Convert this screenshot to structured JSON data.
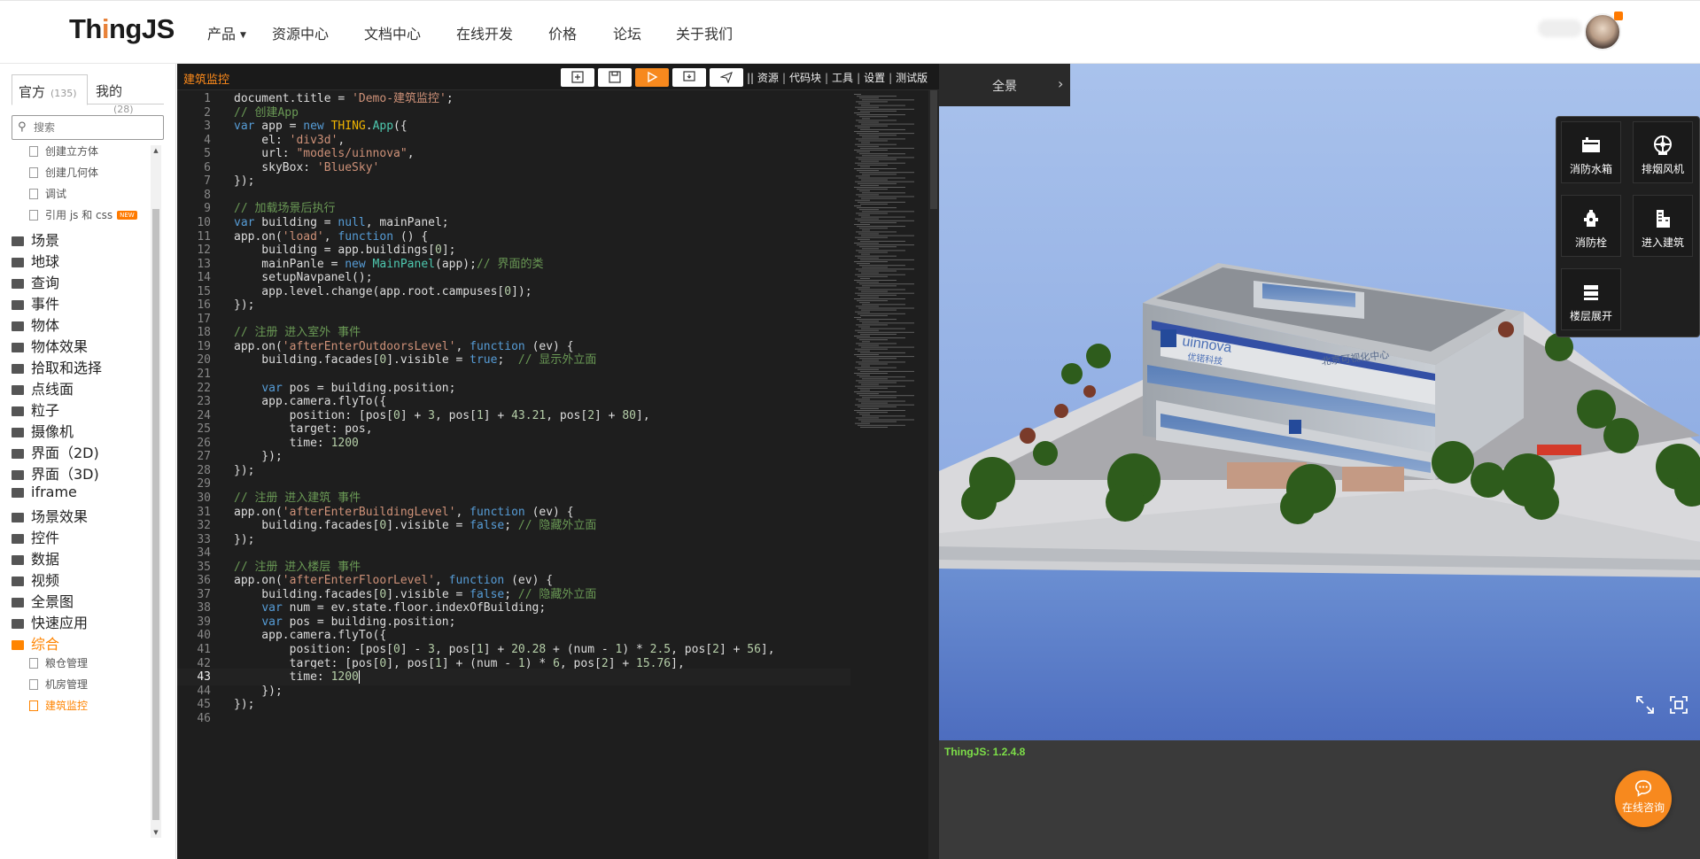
{
  "header": {
    "logo": {
      "prefix": "Th",
      "dot": "i",
      "suffix": "ngJS"
    },
    "nav": [
      {
        "label": "产品",
        "has_dropdown": true
      },
      {
        "label": "资源中心"
      },
      {
        "label": "文档中心"
      },
      {
        "label": "在线开发"
      },
      {
        "label": "价格"
      },
      {
        "label": "论坛"
      },
      {
        "label": "关于我们"
      }
    ]
  },
  "sidebar": {
    "tabs": [
      {
        "label": "官方",
        "count": "(135)",
        "active": true
      },
      {
        "label": "我的",
        "count": "(28)"
      }
    ],
    "search_placeholder": "搜索",
    "items": [
      {
        "type": "sub",
        "label": "创建立方体"
      },
      {
        "type": "sub",
        "label": "创建几何体"
      },
      {
        "type": "sub",
        "label": "调试"
      },
      {
        "type": "sub",
        "label": "引用 js 和 css",
        "badge": "NEW"
      },
      {
        "type": "cat",
        "label": "场景"
      },
      {
        "type": "cat",
        "label": "地球"
      },
      {
        "type": "cat",
        "label": "查询"
      },
      {
        "type": "cat",
        "label": "事件"
      },
      {
        "type": "cat",
        "label": "物体"
      },
      {
        "type": "cat",
        "label": "物体效果"
      },
      {
        "type": "cat",
        "label": "拾取和选择"
      },
      {
        "type": "cat",
        "label": "点线面"
      },
      {
        "type": "cat",
        "label": "粒子"
      },
      {
        "type": "cat",
        "label": "摄像机"
      },
      {
        "type": "cat",
        "label": "界面（2D)"
      },
      {
        "type": "cat",
        "label": "界面（3D)"
      },
      {
        "type": "cat",
        "label": "iframe"
      },
      {
        "type": "cat",
        "label": "场景效果"
      },
      {
        "type": "cat",
        "label": "控件"
      },
      {
        "type": "cat",
        "label": "数据"
      },
      {
        "type": "cat",
        "label": "视频"
      },
      {
        "type": "cat",
        "label": "全景图"
      },
      {
        "type": "cat",
        "label": "快速应用"
      },
      {
        "type": "cat",
        "label": "综合",
        "open": true
      },
      {
        "type": "sub",
        "label": "粮仓管理"
      },
      {
        "type": "sub",
        "label": "机房管理"
      },
      {
        "type": "sub",
        "label": "建筑监控",
        "active": true
      }
    ]
  },
  "editor": {
    "title": "建筑监控",
    "toolbar_buttons": [
      {
        "name": "new-file"
      },
      {
        "name": "save"
      },
      {
        "name": "run"
      },
      {
        "name": "screenshot"
      },
      {
        "name": "share"
      }
    ],
    "toolbar_links": [
      "资源",
      "代码块",
      "工具",
      "设置",
      "测试版"
    ],
    "toolbar_prefix": "||",
    "current_line": 43,
    "code": [
      [
        [
          "p",
          "document.title = "
        ],
        [
          "s",
          "'Demo-建筑监控'"
        ],
        [
          "p",
          ";"
        ]
      ],
      [
        [
          "c",
          "// 创建App"
        ]
      ],
      [
        [
          "k",
          "var"
        ],
        [
          "p",
          " app = "
        ],
        [
          "k",
          "new"
        ],
        [
          "p",
          " "
        ],
        [
          "y",
          "THING"
        ],
        [
          "p",
          "."
        ],
        [
          "t",
          "App"
        ],
        [
          "p",
          "({"
        ]
      ],
      [
        [
          "p",
          "    el: "
        ],
        [
          "s",
          "'div3d'"
        ],
        [
          "p",
          ","
        ]
      ],
      [
        [
          "p",
          "    url: "
        ],
        [
          "s",
          "\"models/uinnova\""
        ],
        [
          "p",
          ","
        ]
      ],
      [
        [
          "p",
          "    skyBox: "
        ],
        [
          "s",
          "'BlueSky'"
        ]
      ],
      [
        [
          "p",
          "});"
        ]
      ],
      [
        [
          "p",
          ""
        ]
      ],
      [
        [
          "c",
          "// 加载场景后执行"
        ]
      ],
      [
        [
          "k",
          "var"
        ],
        [
          "p",
          " building = "
        ],
        [
          "k",
          "null"
        ],
        [
          "p",
          ", mainPanel;"
        ]
      ],
      [
        [
          "p",
          "app.on("
        ],
        [
          "s",
          "'load'"
        ],
        [
          "p",
          ", "
        ],
        [
          "k",
          "function"
        ],
        [
          "p",
          " () {"
        ]
      ],
      [
        [
          "p",
          "    building = app.buildings["
        ],
        [
          "n",
          "0"
        ],
        [
          "p",
          "];"
        ]
      ],
      [
        [
          "p",
          "    mainPanle = "
        ],
        [
          "k",
          "new"
        ],
        [
          "p",
          " "
        ],
        [
          "t",
          "MainPanel"
        ],
        [
          "p",
          "(app);"
        ],
        [
          "c",
          "// 界面的类"
        ]
      ],
      [
        [
          "p",
          "    setupNavpanel();"
        ]
      ],
      [
        [
          "p",
          "    app.level.change(app.root.campuses["
        ],
        [
          "n",
          "0"
        ],
        [
          "p",
          "]);"
        ]
      ],
      [
        [
          "p",
          "});"
        ]
      ],
      [
        [
          "p",
          ""
        ]
      ],
      [
        [
          "c",
          "// 注册 进入室外 事件"
        ]
      ],
      [
        [
          "p",
          "app.on("
        ],
        [
          "s",
          "'afterEnterOutdoorsLevel'"
        ],
        [
          "p",
          ", "
        ],
        [
          "k",
          "function"
        ],
        [
          "p",
          " (ev) {"
        ]
      ],
      [
        [
          "p",
          "    building.facades["
        ],
        [
          "n",
          "0"
        ],
        [
          "p",
          "].visible = "
        ],
        [
          "k",
          "true"
        ],
        [
          "p",
          ";  "
        ],
        [
          "c",
          "// 显示外立面"
        ]
      ],
      [
        [
          "p",
          ""
        ]
      ],
      [
        [
          "p",
          "    "
        ],
        [
          "k",
          "var"
        ],
        [
          "p",
          " pos = building.position;"
        ]
      ],
      [
        [
          "p",
          "    app.camera.flyTo({"
        ]
      ],
      [
        [
          "p",
          "        position: [pos["
        ],
        [
          "n",
          "0"
        ],
        [
          "p",
          "] + "
        ],
        [
          "n",
          "3"
        ],
        [
          "p",
          ", pos["
        ],
        [
          "n",
          "1"
        ],
        [
          "p",
          "] + "
        ],
        [
          "n",
          "43.21"
        ],
        [
          "p",
          ", pos["
        ],
        [
          "n",
          "2"
        ],
        [
          "p",
          "] + "
        ],
        [
          "n",
          "80"
        ],
        [
          "p",
          "],"
        ]
      ],
      [
        [
          "p",
          "        target: pos,"
        ]
      ],
      [
        [
          "p",
          "        time: "
        ],
        [
          "n",
          "1200"
        ]
      ],
      [
        [
          "p",
          "    });"
        ]
      ],
      [
        [
          "p",
          "});"
        ]
      ],
      [
        [
          "p",
          ""
        ]
      ],
      [
        [
          "c",
          "// 注册 进入建筑 事件"
        ]
      ],
      [
        [
          "p",
          "app.on("
        ],
        [
          "s",
          "'afterEnterBuildingLevel'"
        ],
        [
          "p",
          ", "
        ],
        [
          "k",
          "function"
        ],
        [
          "p",
          " (ev) {"
        ]
      ],
      [
        [
          "p",
          "    building.facades["
        ],
        [
          "n",
          "0"
        ],
        [
          "p",
          "].visible = "
        ],
        [
          "k",
          "false"
        ],
        [
          "p",
          "; "
        ],
        [
          "c",
          "// 隐藏外立面"
        ]
      ],
      [
        [
          "p",
          "});"
        ]
      ],
      [
        [
          "p",
          ""
        ]
      ],
      [
        [
          "c",
          "// 注册 进入楼层 事件"
        ]
      ],
      [
        [
          "p",
          "app.on("
        ],
        [
          "s",
          "'afterEnterFloorLevel'"
        ],
        [
          "p",
          ", "
        ],
        [
          "k",
          "function"
        ],
        [
          "p",
          " (ev) {"
        ]
      ],
      [
        [
          "p",
          "    building.facades["
        ],
        [
          "n",
          "0"
        ],
        [
          "p",
          "].visible = "
        ],
        [
          "k",
          "false"
        ],
        [
          "p",
          "; "
        ],
        [
          "c",
          "// 隐藏外立面"
        ]
      ],
      [
        [
          "p",
          "    "
        ],
        [
          "k",
          "var"
        ],
        [
          "p",
          " num = ev.state.floor.indexOfBuilding;"
        ]
      ],
      [
        [
          "p",
          "    "
        ],
        [
          "k",
          "var"
        ],
        [
          "p",
          " pos = building.position;"
        ]
      ],
      [
        [
          "p",
          "    app.camera.flyTo({"
        ]
      ],
      [
        [
          "p",
          "        position: [pos["
        ],
        [
          "n",
          "0"
        ],
        [
          "p",
          "] - "
        ],
        [
          "n",
          "3"
        ],
        [
          "p",
          ", pos["
        ],
        [
          "n",
          "1"
        ],
        [
          "p",
          "] + "
        ],
        [
          "n",
          "20.28"
        ],
        [
          "p",
          " + (num - "
        ],
        [
          "n",
          "1"
        ],
        [
          "p",
          ") * "
        ],
        [
          "n",
          "2.5"
        ],
        [
          "p",
          ", pos["
        ],
        [
          "n",
          "2"
        ],
        [
          "p",
          "] + "
        ],
        [
          "n",
          "56"
        ],
        [
          "p",
          "],"
        ]
      ],
      [
        [
          "p",
          "        target: [pos["
        ],
        [
          "n",
          "0"
        ],
        [
          "p",
          "], pos["
        ],
        [
          "n",
          "1"
        ],
        [
          "p",
          "] + (num - "
        ],
        [
          "n",
          "1"
        ],
        [
          "p",
          ") * "
        ],
        [
          "n",
          "6"
        ],
        [
          "p",
          ", pos["
        ],
        [
          "n",
          "2"
        ],
        [
          "p",
          "] + "
        ],
        [
          "n",
          "15.76"
        ],
        [
          "p",
          "],"
        ]
      ],
      [
        [
          "p",
          "        time: "
        ],
        [
          "n",
          "1200"
        ]
      ],
      [
        [
          "p",
          "    });"
        ]
      ],
      [
        [
          "p",
          "});"
        ]
      ],
      [
        [
          "p",
          ""
        ]
      ]
    ]
  },
  "viewer": {
    "panorama_tab": "全景",
    "building_sign_left": "uinnova",
    "building_sign_cn": "优锘科技",
    "building_sign_right": "北京可视化中心",
    "controls": [
      {
        "label": "消防水箱",
        "icon": "water-tank-icon"
      },
      {
        "label": "排烟风机",
        "icon": "exhaust-fan-icon"
      },
      {
        "label": "消防栓",
        "icon": "hydrant-icon"
      },
      {
        "label": "进入建筑",
        "icon": "building-icon"
      },
      {
        "label": "楼层展开",
        "icon": "floors-icon"
      }
    ],
    "version": "ThingJS: 1.2.4.8",
    "chat_label": "在线咨询"
  },
  "colors": {
    "accent": "#f7891e",
    "editor_bg": "#1e1e1e",
    "version_green": "#7ddf48"
  }
}
